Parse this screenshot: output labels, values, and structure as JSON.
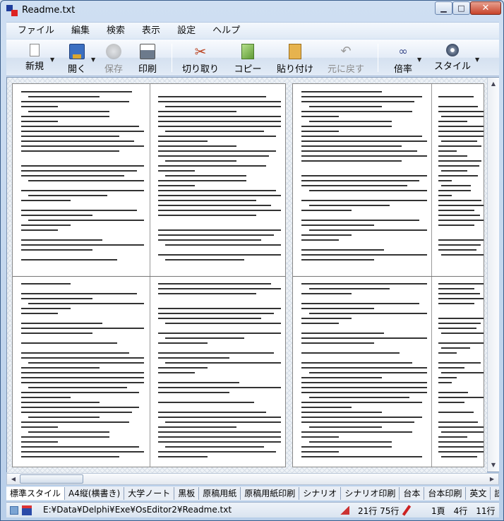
{
  "window": {
    "title": "Readme.txt",
    "close_label": "✕",
    "min_label": "▁",
    "max_label": "□"
  },
  "menu": [
    "ファイル",
    "編集",
    "検索",
    "表示",
    "設定",
    "ヘルプ"
  ],
  "toolbar": {
    "new": "新規",
    "open": "開く",
    "save": "保存",
    "print": "印刷",
    "cut": "切り取り",
    "copy": "コピー",
    "paste": "貼り付け",
    "undo": "元に戻す",
    "zoom": "倍率",
    "style": "スタイル"
  },
  "tabs": [
    "標準スタイル",
    "A4縦(横書き)",
    "大学ノート",
    "黒板",
    "原稿用紙",
    "原稿用紙印刷",
    "シナリオ",
    "シナリオ印刷",
    "台本",
    "台本印刷",
    "英文",
    "読書"
  ],
  "status": {
    "path": "E:¥Data¥Delphi¥Exe¥OsEditor2¥Readme.txt",
    "lines": "21行 75行",
    "pos": "1頁　4行　11行"
  }
}
